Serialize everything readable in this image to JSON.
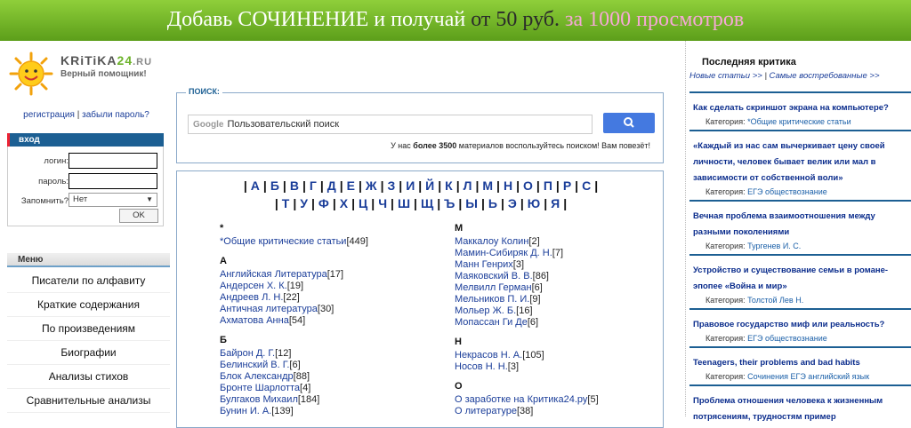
{
  "banner": {
    "part1": "Добавь СОЧИНЕНИЕ и получай",
    "part2": "от 50 руб.",
    "part3": "за 1000 просмотров"
  },
  "logo": {
    "name_a": "KRiTiKA",
    "name_b": "24",
    "name_c": ".RU",
    "tagline": "Верный помощник!"
  },
  "auth": {
    "register": "регистрация",
    "sep": "|",
    "forgot": "забыли пароль?"
  },
  "login": {
    "title": "вход",
    "login_label": "логин:",
    "password_label": "пароль:",
    "remember_label": "Запомнить?",
    "remember_value": "Нет",
    "ok": "OK"
  },
  "menu": {
    "title": "Меню",
    "items": [
      "Писатели по алфавиту",
      "Краткие содержания",
      "По произведениям",
      "Биографии",
      "Анализы стихов",
      "Сравнительные анализы"
    ]
  },
  "search": {
    "legend": "ПОИСК:",
    "google": "Google",
    "placeholder": "Пользовательский поиск",
    "note_pre": "У нас",
    "note_bold": "более 3500",
    "note_post": "материалов воспользуйтесь поиском! Вам повезёт!"
  },
  "alphabet_row1": [
    "А",
    "Б",
    "В",
    "Г",
    "Д",
    "Е",
    "Ж",
    "З",
    "И",
    "Й",
    "К",
    "Л",
    "М",
    "Н",
    "О",
    "П",
    "Р",
    "С"
  ],
  "alphabet_row2": [
    "Т",
    "У",
    "Ф",
    "Х",
    "Ц",
    "Ч",
    "Ш",
    "Щ",
    "Ъ",
    "Ы",
    "Ь",
    "Э",
    "Ю",
    "Я"
  ],
  "authors_left": [
    {
      "letter": "*",
      "items": [
        {
          "name": "*Общие критические статьи",
          "count": "[449]"
        }
      ]
    },
    {
      "letter": "А",
      "items": [
        {
          "name": "Английская Литература",
          "count": "[17]"
        },
        {
          "name": "Андерсен Х. К.",
          "count": "[19]"
        },
        {
          "name": "Андреев Л. Н.",
          "count": "[22]"
        },
        {
          "name": "Античная литература",
          "count": "[30]"
        },
        {
          "name": "Ахматова Анна",
          "count": "[54]"
        }
      ]
    },
    {
      "letter": "Б",
      "items": [
        {
          "name": "Байрон Д. Г.",
          "count": "[12]"
        },
        {
          "name": "Белинский В. Г.",
          "count": "[6]"
        },
        {
          "name": "Блок Александр",
          "count": "[88]"
        },
        {
          "name": "Бронте Шарлотта",
          "count": "[4]"
        },
        {
          "name": "Булгаков Михаил",
          "count": "[184]"
        },
        {
          "name": "Бунин И. А.",
          "count": "[139]"
        }
      ]
    }
  ],
  "authors_right": [
    {
      "letter": "М",
      "items": [
        {
          "name": "Маккалоу Колин",
          "count": "[2]"
        },
        {
          "name": "Мамин-Сибиряк Д. Н.",
          "count": "[7]"
        },
        {
          "name": "Манн Генрих",
          "count": "[3]"
        },
        {
          "name": "Маяковский В. В.",
          "count": "[86]"
        },
        {
          "name": "Мелвилл Герман",
          "count": "[6]"
        },
        {
          "name": "Мельников П. И.",
          "count": "[9]"
        },
        {
          "name": "Мольер Ж. Б.",
          "count": "[16]"
        },
        {
          "name": "Мопассан Ги Де",
          "count": "[6]"
        }
      ]
    },
    {
      "letter": "Н",
      "items": [
        {
          "name": "Некрасов Н. А.",
          "count": "[105]"
        },
        {
          "name": "Носов Н. Н.",
          "count": "[3]"
        }
      ]
    },
    {
      "letter": "О",
      "items": [
        {
          "name": "О заработке на Критика24.ру",
          "count": "[5]"
        },
        {
          "name": "О литературе",
          "count": "[38]"
        }
      ]
    }
  ],
  "right": {
    "title": "Последняя критика",
    "link_new": "Новые статьи >>",
    "link_sep": "|",
    "link_popular": "Самые востребованные >>",
    "category_label": "Категория:",
    "items": [
      {
        "title": "Как сделать скриншот экрана на компьютере?",
        "category": "*Общие критические статьи"
      },
      {
        "title": "«Каждый из нас сам вычеркивает цену своей личности, человек бывает велик или мал в зависимости от собственной воли»",
        "category": "ЕГЭ обществознание"
      },
      {
        "title": "Вечная проблема взаимоотношения между разными поколениями",
        "category": "Тургенев И. С."
      },
      {
        "title": "Устройство и существование семьи в романе-эпопее «Война и мир»",
        "category": "Толстой Лев Н."
      },
      {
        "title": "Правовое государство миф или реальность?",
        "category": "ЕГЭ обществознание"
      },
      {
        "title": "Teenagers, their problems and bad habits",
        "category": "Сочинения ЕГЭ английский язык"
      },
      {
        "title": "Проблема отношения человека к жизненным потрясениям, трудностям пример",
        "category": ""
      }
    ]
  }
}
